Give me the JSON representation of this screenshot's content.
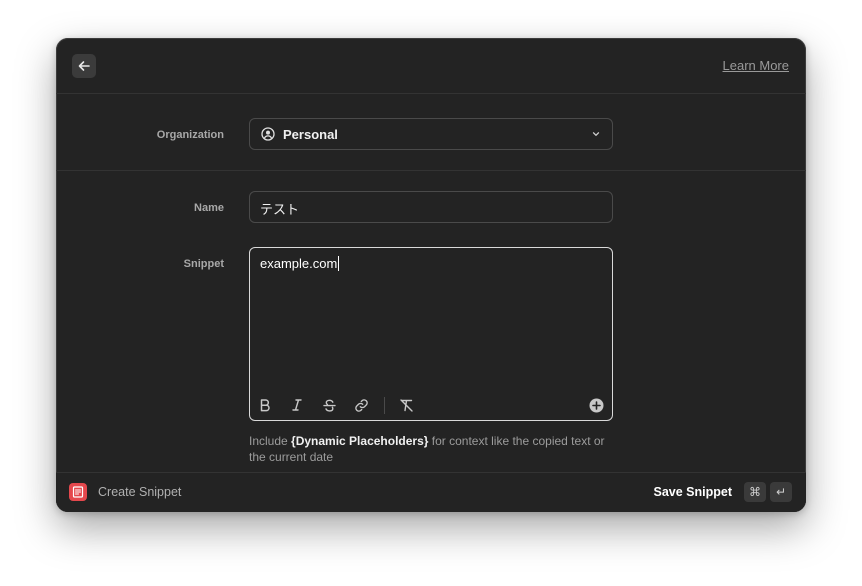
{
  "header": {
    "back_icon": "arrow-left-icon",
    "learn_more": "Learn More"
  },
  "form": {
    "organization": {
      "label": "Organization",
      "icon": "person-circle-icon",
      "value": "Personal"
    },
    "name": {
      "label": "Name",
      "value": "テスト"
    },
    "snippet": {
      "label": "Snippet",
      "value": "example.com",
      "toolbar": [
        "bold-icon",
        "italic-icon",
        "strikethrough-icon",
        "link-icon",
        "clear-format-icon",
        "add-placeholder-icon"
      ]
    },
    "hint": {
      "prefix": "Include ",
      "highlight": "{Dynamic Placeholders}",
      "suffix": " for context like the copied text or the current date"
    }
  },
  "footer": {
    "title": "Create Snippet",
    "app_icon_color": "#e5484d",
    "action_label": "Save Snippet",
    "shortcut_cmd": "⌘",
    "shortcut_enter": "↵"
  }
}
